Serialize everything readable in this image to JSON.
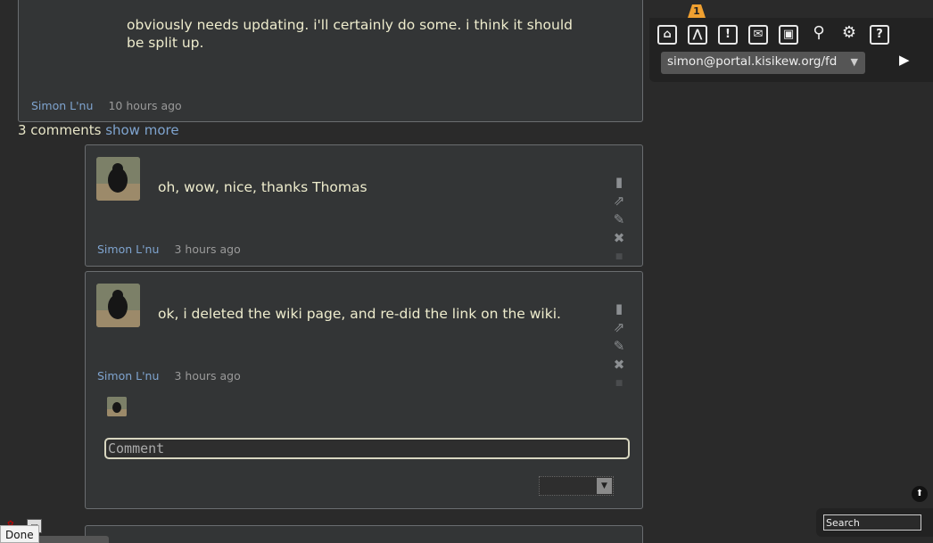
{
  "post": {
    "body": "obviously needs updating. i'll certainly do some. i think it should be split up.",
    "author": "Simon L'nu",
    "time": "10 hours ago"
  },
  "comments_summary": {
    "count_text": "3 comments",
    "show_more": "show more"
  },
  "comments": [
    {
      "text": "oh, wow, nice, thanks Thomas",
      "author": "Simon L'nu",
      "time": "3 hours ago"
    },
    {
      "text": "ok, i deleted the wiki page, and re-did the link on the wiki.",
      "author": "Simon L'nu",
      "time": "3 hours ago"
    }
  ],
  "comment_box": {
    "placeholder": "Comment"
  },
  "nav": {
    "notification_count": "1",
    "icons": [
      "home-icon",
      "network-icon",
      "notifications-icon",
      "messages-icon",
      "manage-icon",
      "settings-icon",
      "admin-icon",
      "help-icon"
    ],
    "identity": "simon@portal.kisikew.org/fd"
  },
  "search": {
    "placeholder": "Search"
  },
  "status_bar": {
    "text": "Done"
  },
  "colors": {
    "background": "#2a2a2a",
    "card": "#333536",
    "link": "#7fa4cf",
    "badge": "#f0a030"
  }
}
